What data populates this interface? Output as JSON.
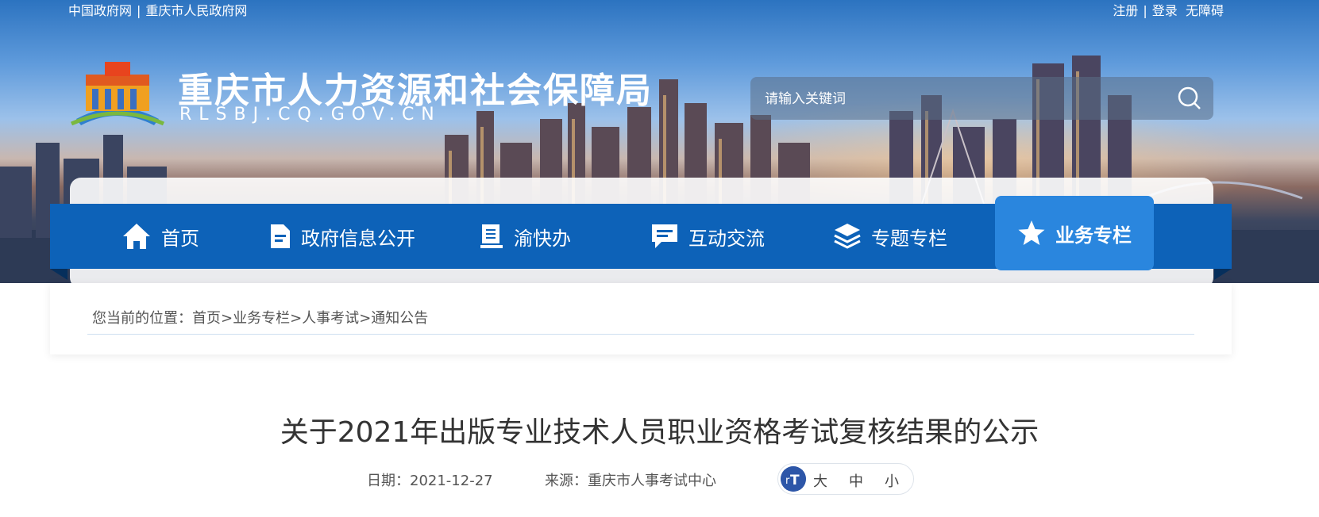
{
  "top_links": {
    "left": [
      "中国政府网",
      "重庆市人民政府网"
    ],
    "right": [
      "注册",
      "登录",
      "无障碍"
    ]
  },
  "header": {
    "title": "重庆市人力资源和社会保障局",
    "domain": "RLSBJ.CQ.GOV.CN"
  },
  "search": {
    "placeholder": "请输入关键词"
  },
  "nav": {
    "items": [
      {
        "label": "首页",
        "icon": "home-icon"
      },
      {
        "label": "政府信息公开",
        "icon": "document-icon"
      },
      {
        "label": "渝快办",
        "icon": "book-icon"
      },
      {
        "label": "互动交流",
        "icon": "chat-icon"
      },
      {
        "label": "专题专栏",
        "icon": "layers-icon"
      },
      {
        "label": "业务专栏",
        "icon": "star-icon"
      }
    ],
    "active_index": 5
  },
  "breadcrumb": {
    "prefix": "您当前的位置：",
    "items": [
      "首页",
      "业务专栏",
      "人事考试",
      "通知公告"
    ],
    "separator": ">"
  },
  "article": {
    "title": "关于2021年出版专业技术人员职业资格考试复核结果的公示",
    "date_label": "日期：",
    "date": "2021-12-27",
    "source_label": "来源：",
    "source": "重庆市人事考试中心"
  },
  "font_size": {
    "options": [
      "大",
      "中",
      "小"
    ]
  },
  "colors": {
    "nav_blue": "#0d62b8",
    "nav_active": "#2a86de",
    "title_text": "#333333"
  }
}
